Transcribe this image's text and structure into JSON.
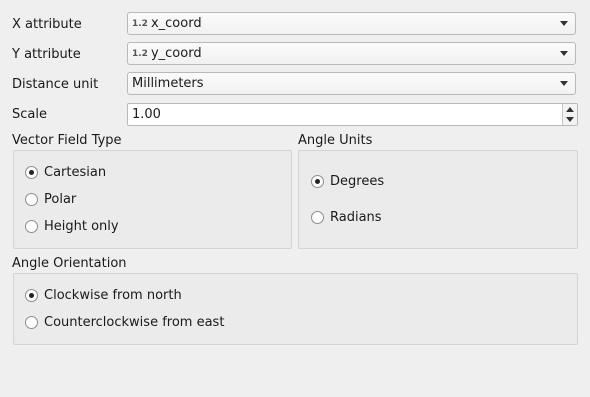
{
  "fields": {
    "x_attribute": {
      "label": "X attribute",
      "type_badge": "1.2",
      "value": "x_coord"
    },
    "y_attribute": {
      "label": "Y attribute",
      "type_badge": "1.2",
      "value": "y_coord"
    },
    "distance_unit": {
      "label": "Distance unit",
      "value": "Millimeters"
    },
    "scale": {
      "label": "Scale",
      "value": "1.00"
    }
  },
  "vector_field_type": {
    "title": "Vector Field Type",
    "options": [
      "Cartesian",
      "Polar",
      "Height only"
    ],
    "selected": "Cartesian"
  },
  "angle_units": {
    "title": "Angle Units",
    "options": [
      "Degrees",
      "Radians"
    ],
    "selected": "Degrees"
  },
  "angle_orientation": {
    "title": "Angle Orientation",
    "options": [
      "Clockwise from north",
      "Counterclockwise from east"
    ],
    "selected": "Clockwise from north"
  },
  "icons": {
    "dropdown": "chevron-down-icon",
    "spin_up": "spin-up-icon",
    "spin_down": "spin-down-icon"
  }
}
